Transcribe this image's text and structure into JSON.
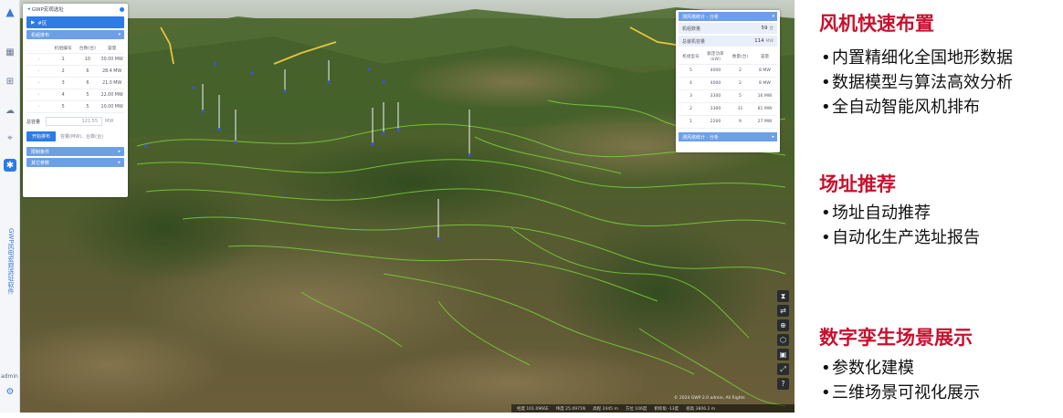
{
  "app": {
    "rail": {
      "title": "GWP风电宏观选址软件",
      "user": "admin"
    },
    "left_panel": {
      "header": "GWP宏观选址",
      "block": "#区",
      "section1": "机组排布",
      "columns": [
        "机组编号",
        "台数(台)",
        "容量"
      ],
      "rows": [
        [
          "1",
          "10",
          "30.00 MW"
        ],
        [
          "2",
          "6",
          "28.4 MW"
        ],
        [
          "3",
          "6",
          "21.0 MW"
        ],
        [
          "4",
          "5",
          "22.00 MW"
        ],
        [
          "5",
          "5",
          "10.00 MW"
        ]
      ],
      "total_label": "总容量",
      "total_value": "121.55",
      "total_unit": "MW",
      "button": "开始排布",
      "hint": "容量(MW)、台数(台)",
      "section2": "限制条件",
      "section3": "其它参数"
    },
    "right_panel": {
      "header": "测风塔统计 - 分析",
      "stat1_label": "机组数量",
      "stat1_value": "59",
      "stat1_unit": "台",
      "stat2_label": "总装机容量",
      "stat2_value": "114",
      "stat2_unit": "MW",
      "columns": [
        "机组型号",
        "额定功率(kW)",
        "数量(台)",
        "容量"
      ],
      "rows": [
        [
          "5",
          "4000",
          "2",
          "8 MW"
        ],
        [
          "4",
          "4000",
          "2",
          "8 MW"
        ],
        [
          "3",
          "3300",
          "5",
          "16 MW"
        ],
        [
          "2",
          "3300",
          "31",
          "81 MW"
        ],
        [
          "1",
          "2200",
          "9",
          "27 MW"
        ]
      ],
      "footer": "测风塔统计 - 分析"
    },
    "tools": [
      "⧗",
      "⇄",
      "⊕",
      "⬡",
      "▣",
      "⤢",
      "?"
    ],
    "statusbar": [
      "经度 101.0966E",
      "纬度 25.0971N",
      "高程 2445 m",
      "方位 106度",
      "俯仰角 -13度",
      "视高 3806.2 m"
    ],
    "copyright": "© 2024 GWP 2.0 admin, All Rights"
  },
  "features": [
    {
      "title": "风机快速布置",
      "items": [
        "内置精细化全国地形数据",
        "数据模型与算法高效分析",
        "全自动智能风机排布"
      ]
    },
    {
      "title": "场址推荐",
      "items": [
        "场址自动推荐",
        "自动化生产选址报告"
      ]
    },
    {
      "title": "数字孪生场景展示",
      "items": [
        "参数化建模",
        "三维场景可视化展示"
      ]
    }
  ],
  "colors": {
    "accent_red": "#c8102e",
    "ui_blue": "#2d7be5",
    "contour_green": "#7cd13a"
  }
}
